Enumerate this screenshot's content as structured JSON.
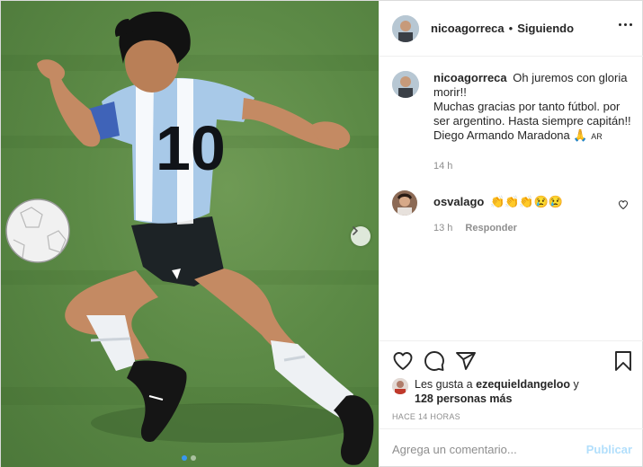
{
  "post": {
    "username": "nicoagorreca",
    "separator": "•",
    "follow_status": "Siguiendo",
    "more_icon": "more-horizontal-icon"
  },
  "caption": {
    "username": "nicoagorreca",
    "line1": "Oh juremos con gloria morir!!",
    "line2": "Muchas gracias por tanto fútbol. por ser argentino. Hasta siempre capitán!!",
    "line3": "Diego Armando Maradona 🙏",
    "flag_text": "AR",
    "time": "14 h"
  },
  "comments": [
    {
      "username": "osvalago",
      "text": "👏👏👏😢😢",
      "time": "13 h",
      "reply_label": "Responder"
    }
  ],
  "likes": {
    "prefix": "Les gusta a",
    "user": "ezequieldangeloo",
    "conj": "y",
    "others": "128 personas más"
  },
  "time_ago": "HACE 14 HORAS",
  "comment_box": {
    "placeholder": "Agrega un comentario...",
    "publish_label": "Publicar"
  },
  "carousel": {
    "slides": 2,
    "current": 1
  },
  "colors": {
    "accent": "#3897f0",
    "publish_disabled": "#b2dffc",
    "meta_gray": "#8e8e8e",
    "border": "#efefef"
  }
}
